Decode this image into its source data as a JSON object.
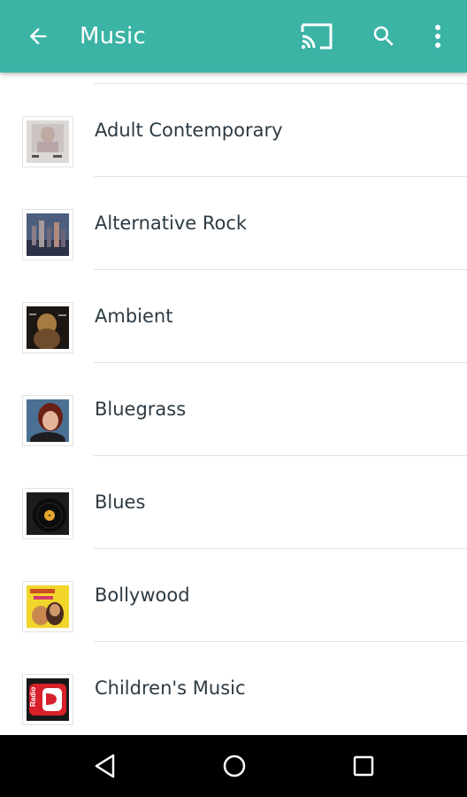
{
  "app_bar": {
    "title": "Music",
    "background_color": "#3bb3a5",
    "icons": [
      "arrow-back-icon",
      "cast-icon",
      "search-icon",
      "more-vert-icon"
    ]
  },
  "genres": [
    {
      "label": "Adult Contemporary",
      "thumbnail": "album-art-adult-contemporary"
    },
    {
      "label": "Alternative Rock",
      "thumbnail": "album-art-alternative-rock"
    },
    {
      "label": "Ambient",
      "thumbnail": "album-art-ambient"
    },
    {
      "label": "Bluegrass",
      "thumbnail": "album-art-bluegrass"
    },
    {
      "label": "Blues",
      "thumbnail": "album-art-blues"
    },
    {
      "label": "Bollywood",
      "thumbnail": "album-art-bollywood"
    },
    {
      "label": "Children's Music",
      "thumbnail": "album-art-childrens-music",
      "thumbnail_text": "Radio"
    }
  ],
  "nav_bar": {
    "icons": [
      "nav-back-icon",
      "nav-home-icon",
      "nav-recents-icon"
    ]
  },
  "colors": {
    "text": "#2d3a43",
    "divider": "#e3e3e3",
    "nav_bar": "#000000"
  }
}
